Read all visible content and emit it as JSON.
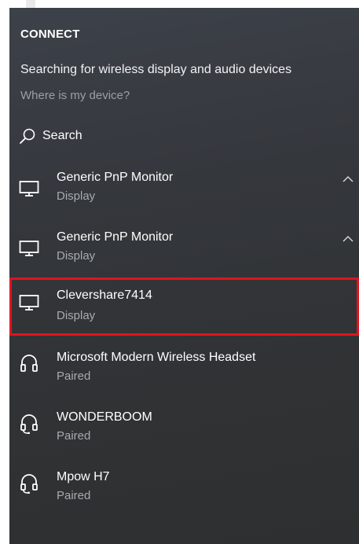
{
  "panel": {
    "title": "CONNECT",
    "status": "Searching for wireless display and audio devices",
    "help_link": "Where is my device?",
    "search_label": "Search"
  },
  "devices": [
    {
      "name": "Generic PnP Monitor",
      "status": "Display",
      "icon": "monitor-icon",
      "expanded_chevron": true,
      "selected": false
    },
    {
      "name": "Generic PnP Monitor",
      "status": "Display",
      "icon": "monitor-icon",
      "expanded_chevron": true,
      "selected": false
    },
    {
      "name": "Clevershare7414",
      "status": "Display",
      "icon": "monitor-icon",
      "expanded_chevron": false,
      "selected": true
    },
    {
      "name": "Microsoft Modern Wireless Headset",
      "status": "Paired",
      "icon": "headphones-icon",
      "expanded_chevron": false,
      "selected": false
    },
    {
      "name": "WONDERBOOM",
      "status": "Paired",
      "icon": "headset-icon",
      "expanded_chevron": false,
      "selected": false
    },
    {
      "name": "Mpow H7",
      "status": "Paired",
      "icon": "headset-icon",
      "expanded_chevron": false,
      "selected": false
    }
  ],
  "colors": {
    "panel_background": "#34373c",
    "text_primary": "#ffffff",
    "text_secondary": "#a7abb0",
    "link_color": "#9aa0a6",
    "selection_outline": "#e0141e"
  }
}
